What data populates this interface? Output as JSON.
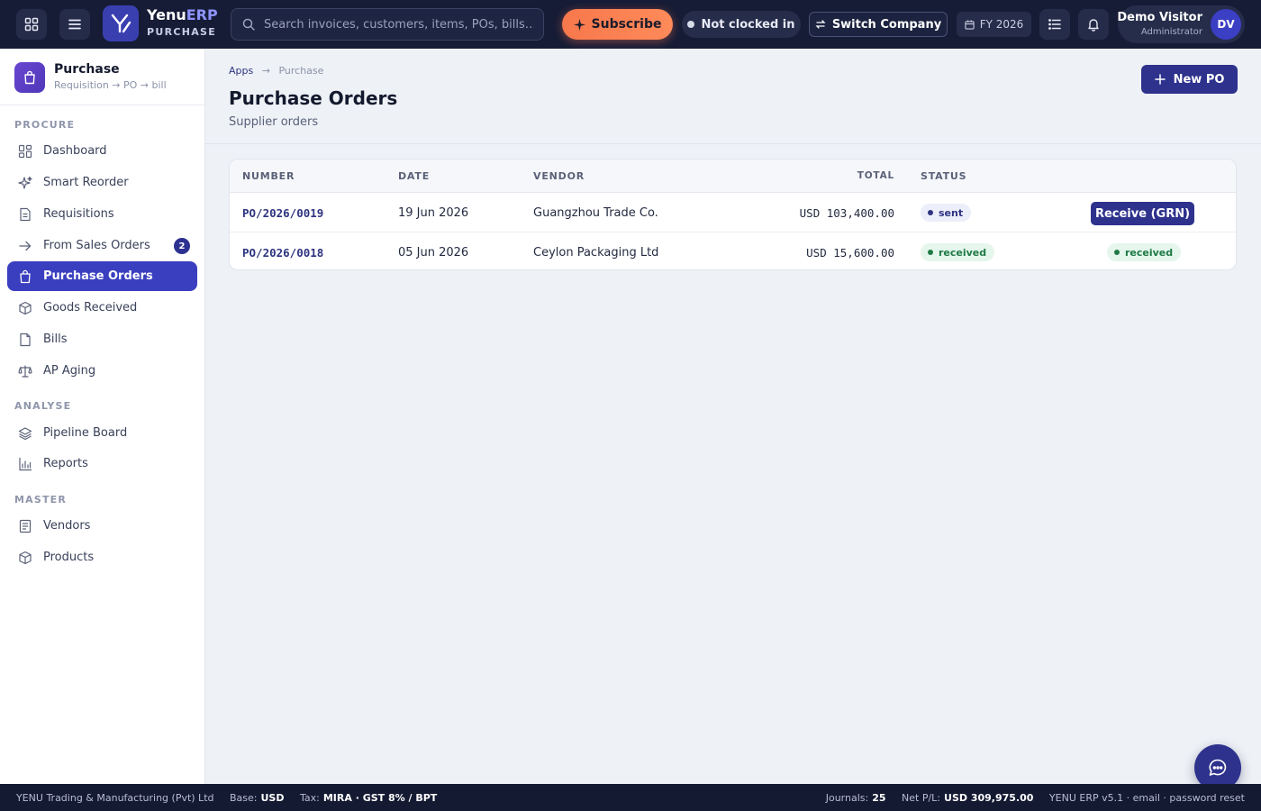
{
  "app": {
    "name_main": "Yenu",
    "name_accent": "ERP",
    "module": "PURCHASE"
  },
  "topbar": {
    "search_placeholder": "Search invoices, customers, items, POs, bills…",
    "subscribe_label": "Subscribe",
    "clock_status": "Not clocked in",
    "switch_company_label": "Switch Company",
    "fiscal_year": "FY 2026",
    "user": {
      "name": "Demo Visitor",
      "role": "Administrator",
      "initials": "DV"
    }
  },
  "sidebar": {
    "app_title": "Purchase",
    "app_subtitle": "Requisition → PO → bill",
    "sections": {
      "procure": "PROCURE",
      "analyse": "ANALYSE",
      "master": "MASTER"
    },
    "items": [
      {
        "label": "Dashboard",
        "icon": "dashboard-icon"
      },
      {
        "label": "Smart Reorder",
        "icon": "sparkle-icon"
      },
      {
        "label": "Requisitions",
        "icon": "document-icon"
      },
      {
        "label": "From Sales Orders",
        "icon": "arrow-right-icon",
        "badge": "2"
      },
      {
        "label": "Purchase Orders",
        "icon": "shopping-bag-icon",
        "active": true
      },
      {
        "label": "Goods Received",
        "icon": "box-icon"
      },
      {
        "label": "Bills",
        "icon": "file-icon"
      },
      {
        "label": "AP Aging",
        "icon": "scale-icon"
      },
      {
        "label": "Pipeline Board",
        "icon": "layers-icon"
      },
      {
        "label": "Reports",
        "icon": "bar-chart-icon"
      },
      {
        "label": "Vendors",
        "icon": "list-icon"
      },
      {
        "label": "Products",
        "icon": "cube-icon"
      }
    ]
  },
  "page": {
    "breadcrumb": {
      "root": "Apps",
      "separator": "→",
      "current": "Purchase"
    },
    "title": "Purchase Orders",
    "subtitle": "Supplier orders",
    "new_button": "New PO"
  },
  "table": {
    "columns": {
      "number": "NUMBER",
      "date": "DATE",
      "vendor": "VENDOR",
      "total": "TOTAL",
      "status": "STATUS"
    },
    "rows": [
      {
        "number": "PO/2026/0019",
        "date": "19 Jun 2026",
        "vendor": "Guangzhou Trade Co.",
        "total": "USD 103,400.00",
        "status": "sent",
        "action": "Receive (GRN)"
      },
      {
        "number": "PO/2026/0018",
        "date": "05 Jun 2026",
        "vendor": "Ceylon Packaging Ltd",
        "total": "USD 15,600.00",
        "status": "received",
        "action": "received"
      }
    ]
  },
  "footer": {
    "company": "YENU Trading & Manufacturing (Pvt) Ltd",
    "base_label": "Base:",
    "base_value": "USD",
    "tax_label": "Tax:",
    "tax_value": "MIRA · GST 8% / BPT",
    "journals_label": "Journals:",
    "journals_value": "25",
    "netpl_label": "Net P/L:",
    "netpl_value": "USD 309,975.00",
    "version": "YENU ERP v5.1 · email · password reset"
  },
  "colors": {
    "topbar_bg": "#161c36",
    "accent": "#3a3fc0",
    "subscribe": "#f7784c",
    "status_sent": "#2e3480",
    "status_received": "#1f7a46"
  }
}
